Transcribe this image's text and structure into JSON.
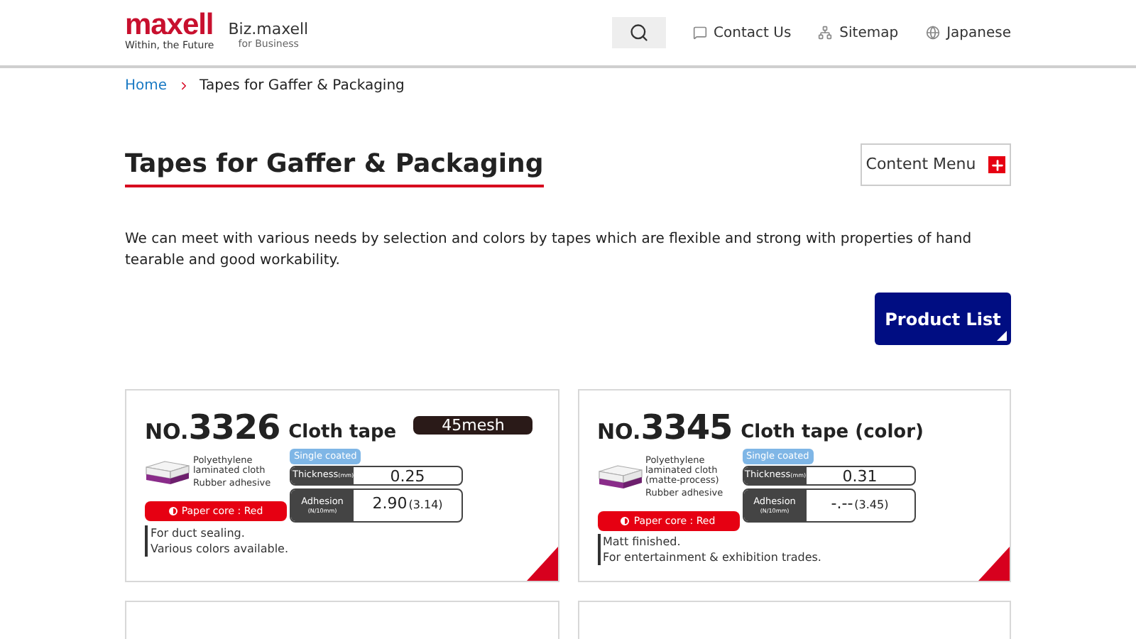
{
  "header": {
    "logo": {
      "brand": "maxell",
      "tagline": "Within, the Future"
    },
    "sub_brand": {
      "name": "Biz.maxell",
      "tagline": "for Business"
    },
    "nav": [
      {
        "label": "Contact Us",
        "kind": "chat"
      },
      {
        "label": "Sitemap",
        "kind": "sitemap"
      },
      {
        "label": "Japanese",
        "kind": "globe"
      }
    ]
  },
  "breadcrumb": [
    {
      "label": "Home",
      "kind": "link"
    },
    {
      "label": "Tapes for Gaffer & Packaging",
      "kind": "current"
    }
  ],
  "title": "Tapes for Gaffer & Packaging",
  "content_menu_button": "Content Menu",
  "intro": "We can meet with various needs by selection and colors by tapes which are flexible and strong with properties of hand tearable and good workability.",
  "product_list_button": "Product List",
  "products": [
    {
      "kind": "full",
      "prefix": "NO.",
      "number": "3326",
      "name": "Cloth tape",
      "badge": "45mesh",
      "layers": [
        "Polyethylene laminated cloth",
        "Rubber adhesive"
      ],
      "coating": "Single coated",
      "thickness_label": "Thickness",
      "thickness_unit": "(mm)",
      "thickness": "0.25",
      "adhesion_label": "Adhesion",
      "adhesion_unit": "(N/10mm)",
      "adhesion": "2.90",
      "adhesion_paren": "(3.14)",
      "core": "Paper core : Red",
      "notes": [
        "For duct sealing.",
        "Various colors available."
      ]
    },
    {
      "kind": "full",
      "prefix": "NO.",
      "number": "3345",
      "name": "Cloth tape (color)",
      "layers": [
        "Polyethylene laminated cloth (matte-process)",
        "Rubber adhesive"
      ],
      "coating": "Single coated",
      "thickness_label": "Thickness",
      "thickness_unit": "(mm)",
      "thickness": "0.31",
      "adhesion_label": "Adhesion",
      "adhesion_unit": "(N/10mm)",
      "adhesion": "-.--",
      "adhesion_paren": "(3.45)",
      "core": "Paper core : Red",
      "notes": [
        "Matt finished.",
        "For entertainment & exhibition trades."
      ]
    },
    {
      "kind": "cut"
    },
    {
      "kind": "cut"
    }
  ]
}
